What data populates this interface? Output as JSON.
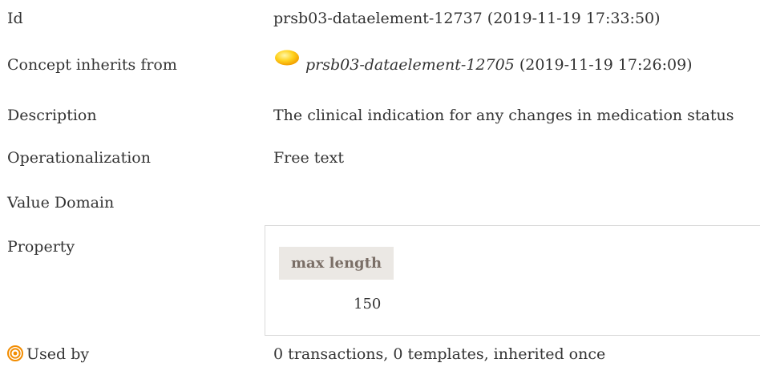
{
  "fields": {
    "id": {
      "label": "Id",
      "value": "prsb03-dataelement-12737 (2019-11-19 17:33:50)"
    },
    "inherits": {
      "label": "Concept inherits from",
      "concept_link": "prsb03-dataelement-12705",
      "concept_date": "(2019-11-19 17:26:09)",
      "icon": "sun-icon"
    },
    "description": {
      "label": "Description",
      "value": "The clinical indication for any changes in medication status"
    },
    "operationalization": {
      "label": "Operationalization",
      "value": "Free text"
    },
    "value_domain": {
      "label": "Value Domain"
    },
    "property": {
      "label": "Property",
      "header": "max length",
      "value": "150"
    },
    "used_by": {
      "label": "Used by",
      "value": "0 transactions, 0 templates, inherited once",
      "icon": "target-icon"
    }
  }
}
